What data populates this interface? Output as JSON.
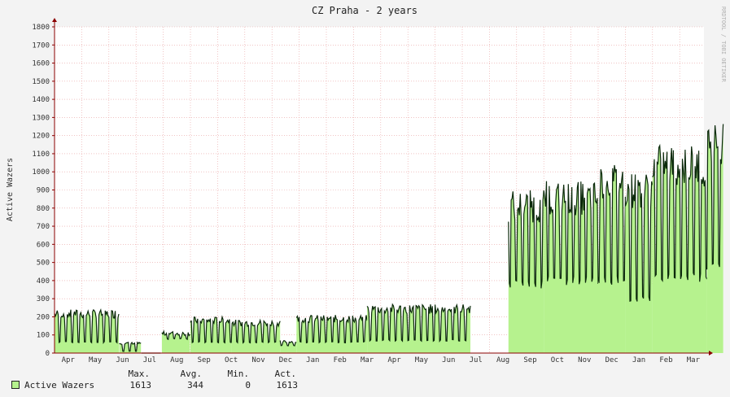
{
  "chart_data": {
    "type": "area",
    "title": "CZ Praha - 2 years",
    "watermark": "RRDTOOL / TOBI OETIKER",
    "ylabel": "Active Wazers",
    "ylim": [
      0,
      1800
    ],
    "yticks": [
      0,
      100,
      200,
      300,
      400,
      500,
      600,
      700,
      800,
      900,
      1000,
      1100,
      1200,
      1300,
      1400,
      1500,
      1600,
      1700,
      1800
    ],
    "xlabels": [
      "Apr",
      "May",
      "Jun",
      "Jul",
      "Aug",
      "Sep",
      "Oct",
      "Nov",
      "Dec",
      "Jan",
      "Feb",
      "Mar",
      "Apr",
      "May",
      "Jun",
      "Jul",
      "Aug",
      "Sep",
      "Oct",
      "Nov",
      "Dec",
      "Jan",
      "Feb",
      "Mar"
    ],
    "grid": true,
    "colors": {
      "line": "#0C2A0C",
      "fill": "#B6F28E",
      "fill_recent": "#ECFFE4",
      "grid": "#E8A0A0",
      "axis": "#8B0000",
      "background": "#FFFFFF",
      "canvas": "#F3F3F3"
    },
    "series": [
      {
        "name": "Active Wazers",
        "segments": [
          {
            "start": 0.0,
            "end": 2.38,
            "low": 60,
            "high": 240
          },
          {
            "start": 2.38,
            "end": 3.2,
            "low": 10,
            "high": 60
          },
          {
            "start": 3.2,
            "end": 3.9,
            "low": 0,
            "high": 0
          },
          {
            "start": 3.95,
            "end": 5.0,
            "low": 80,
            "high": 120
          },
          {
            "start": 5.0,
            "end": 6.5,
            "low": 60,
            "high": 200
          },
          {
            "start": 6.5,
            "end": 8.3,
            "low": 60,
            "high": 185
          },
          {
            "start": 8.3,
            "end": 8.9,
            "low": 40,
            "high": 70
          },
          {
            "start": 8.9,
            "end": 11.5,
            "low": 60,
            "high": 210
          },
          {
            "start": 11.5,
            "end": 15.3,
            "low": 70,
            "high": 270
          },
          {
            "start": 16.7,
            "end": 18.0,
            "low": 380,
            "high": 900
          },
          {
            "start": 18.0,
            "end": 20.0,
            "low": 400,
            "high": 950
          },
          {
            "start": 20.0,
            "end": 21.0,
            "low": 400,
            "high": 1050
          },
          {
            "start": 21.0,
            "end": 22.0,
            "low": 300,
            "high": 1000
          },
          {
            "start": 22.0,
            "end": 24.0,
            "low": 420,
            "high": 1150
          },
          {
            "start": 24.0,
            "end": 24.6,
            "low": 480,
            "high": 1300
          }
        ],
        "last": 1613
      }
    ]
  },
  "legend": {
    "headers": [
      "Max.",
      "Avg.",
      "Min.",
      "Act."
    ],
    "label": "Active Wazers",
    "values": [
      "1613",
      "344",
      "0",
      "1613"
    ]
  }
}
